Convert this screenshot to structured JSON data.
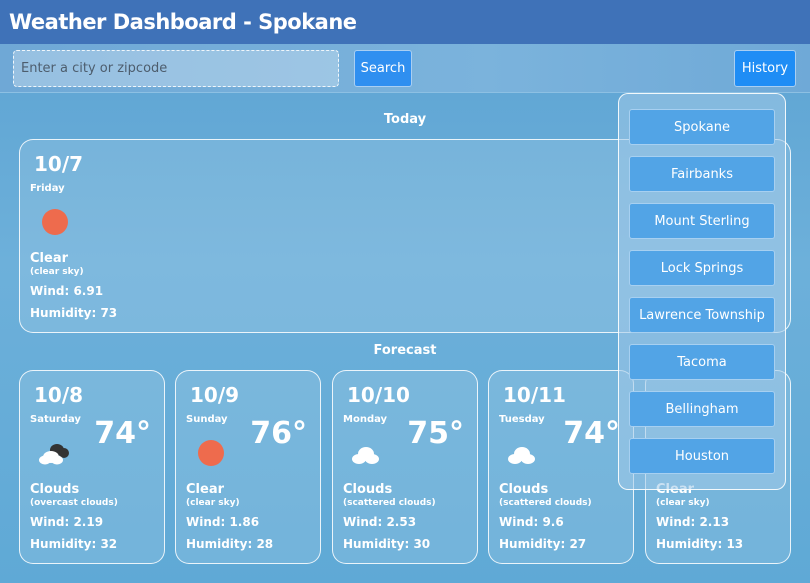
{
  "header": {
    "title": "Weather Dashboard - Spokane"
  },
  "search": {
    "placeholder": "Enter a city or zipcode",
    "button_label": "Search"
  },
  "history": {
    "button_label": "History",
    "items": [
      "Spokane",
      "Fairbanks",
      "Mount Sterling",
      "Lock Springs",
      "Lawrence Township",
      "Tacoma",
      "Bellingham",
      "Houston"
    ]
  },
  "today": {
    "label": "Today",
    "date": "10/7",
    "day": "Friday",
    "icon": "sun-icon",
    "condition": "Clear",
    "description": "(clear sky)",
    "wind": "Wind: 6.91",
    "humidity": "Humidity: 73"
  },
  "forecast": {
    "label": "Forecast",
    "days": [
      {
        "date": "10/8",
        "day": "Saturday",
        "temp": "74°",
        "icon": "broken-clouds-icon",
        "condition": "Clouds",
        "description": "(overcast clouds)",
        "wind": "Wind: 2.19",
        "humidity": "Humidity: 32"
      },
      {
        "date": "10/9",
        "day": "Sunday",
        "temp": "76°",
        "icon": "sun-icon",
        "condition": "Clear",
        "description": "(clear sky)",
        "wind": "Wind: 1.86",
        "humidity": "Humidity: 28"
      },
      {
        "date": "10/10",
        "day": "Monday",
        "temp": "75°",
        "icon": "cloud-icon",
        "condition": "Clouds",
        "description": "(scattered clouds)",
        "wind": "Wind: 2.53",
        "humidity": "Humidity: 30"
      },
      {
        "date": "10/11",
        "day": "Tuesday",
        "temp": "74°",
        "icon": "cloud-icon",
        "condition": "Clouds",
        "description": "(scattered clouds)",
        "wind": "Wind: 9.6",
        "humidity": "Humidity: 27"
      },
      {
        "date": "",
        "day": "",
        "temp": "",
        "icon": "",
        "condition": "Clear",
        "description": "(clear sky)",
        "wind": "Wind: 2.13",
        "humidity": "Humidity: 13"
      }
    ]
  },
  "colors": {
    "header": "#3f72b8",
    "button": "#2f8ff0",
    "sun": "#ee6b4d",
    "history_item": "#52a4e6"
  }
}
